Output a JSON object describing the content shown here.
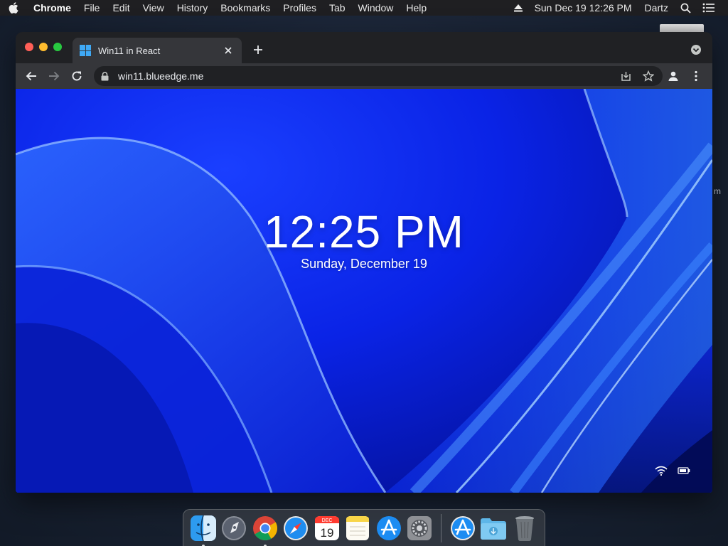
{
  "menubar": {
    "app_name": "Chrome",
    "menus": [
      "File",
      "Edit",
      "View",
      "History",
      "Bookmarks",
      "Profiles",
      "Tab",
      "Window",
      "Help"
    ],
    "datetime": "Sun Dec 19  12:26 PM",
    "user": "Dartz",
    "icons": [
      "apple-icon",
      "eject-icon",
      "spotlight-search-icon",
      "control-center-icon"
    ]
  },
  "desktop": {
    "edge_letter": "m"
  },
  "browser": {
    "tab": {
      "title": "Win11 in React",
      "favicon": "windows-logo-icon"
    },
    "url": "win11.blueedge.me",
    "toolbar_icons": [
      "back-arrow-icon",
      "forward-arrow-icon",
      "reload-icon",
      "lock-icon",
      "install-app-icon",
      "bookmark-star-icon",
      "profile-icon",
      "more-vertical-icon"
    ]
  },
  "lockscreen": {
    "time": "12:25 PM",
    "date": "Sunday, December 19",
    "status_icons": [
      "wifi-icon",
      "battery-icon"
    ]
  },
  "dock": {
    "calendar_month": "DEC",
    "calendar_day": "19",
    "apps": [
      "finder-icon",
      "launchpad-icon",
      "chrome-icon",
      "safari-icon",
      "calendar-icon",
      "notes-icon",
      "app-store-icon",
      "system-preferences-icon",
      "app-store-download-icon",
      "downloads-folder-icon",
      "trash-icon"
    ]
  },
  "colors": {
    "menubar_bg": "#1f1f22",
    "chrome_frame": "#202124",
    "chrome_toolbar": "#35363a",
    "wallpaper_blue": "#0a23e6",
    "traffic_close": "#ff5f57",
    "traffic_minimize": "#febc2e",
    "traffic_maximize": "#28c840"
  }
}
